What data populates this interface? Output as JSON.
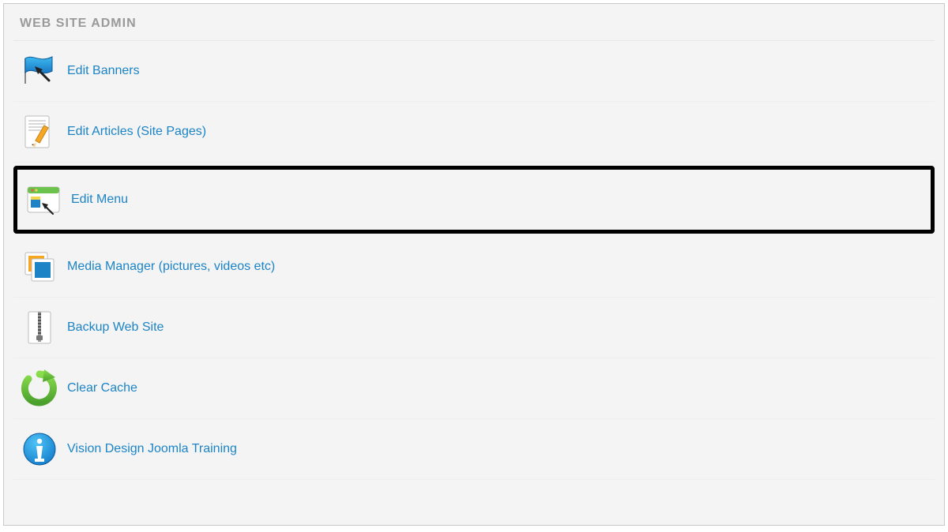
{
  "panel": {
    "title": "WEB SITE ADMIN",
    "items": [
      {
        "label": "Edit Banners",
        "icon": "banner-flag-icon",
        "highlighted": false
      },
      {
        "label": "Edit Articles (Site Pages)",
        "icon": "article-pencil-icon",
        "highlighted": false
      },
      {
        "label": "Edit Menu",
        "icon": "menu-window-icon",
        "highlighted": true
      },
      {
        "label": "Media Manager (pictures, videos etc)",
        "icon": "media-pictures-icon",
        "highlighted": false
      },
      {
        "label": "Backup Web Site",
        "icon": "zip-file-icon",
        "highlighted": false
      },
      {
        "label": "Clear Cache",
        "icon": "refresh-icon",
        "highlighted": false
      },
      {
        "label": "Vision Design Joomla Training",
        "icon": "info-icon",
        "highlighted": false
      }
    ]
  },
  "colors": {
    "link": "#1c84c6",
    "title": "#9a9a9a",
    "highlight_border": "#000000"
  }
}
